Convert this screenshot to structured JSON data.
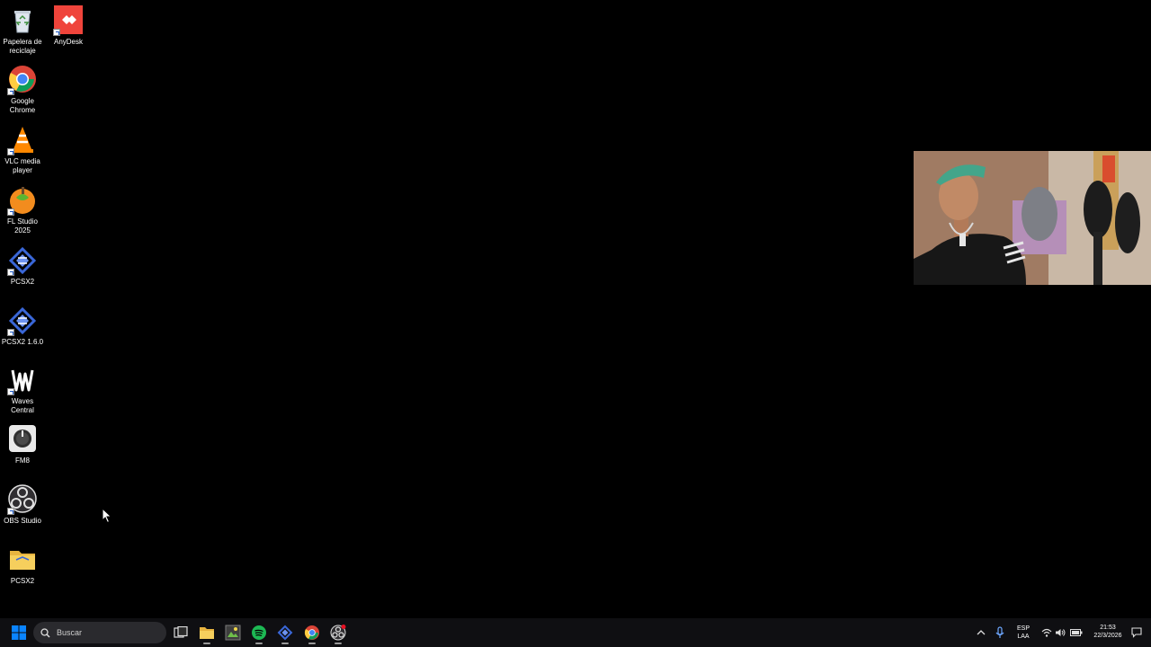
{
  "desktop": {
    "icons": [
      {
        "id": "recycle-bin",
        "label": "Papelera de reciclaje"
      },
      {
        "id": "anydesk",
        "label": "AnyDesk"
      },
      {
        "id": "chrome",
        "label": "Google Chrome"
      },
      {
        "id": "vlc",
        "label": "VLC media player"
      },
      {
        "id": "fl-studio",
        "label": "FL Studio 2025"
      },
      {
        "id": "pcsx2",
        "label": "PCSX2"
      },
      {
        "id": "pcsx2-160",
        "label": "PCSX2 1.6.0"
      },
      {
        "id": "waves",
        "label": "Waves Central"
      },
      {
        "id": "fm8",
        "label": "FM8"
      },
      {
        "id": "obs",
        "label": "OBS Studio"
      },
      {
        "id": "pcsx2-folder",
        "label": "PCSX2"
      }
    ]
  },
  "taskbar": {
    "search_placeholder": "Buscar",
    "apps": [
      "task-view",
      "file-explorer",
      "image-app",
      "spotify",
      "pcsx2",
      "chrome",
      "obs"
    ],
    "tray": {
      "language_line1": "ESP",
      "language_line2": "LAA",
      "time": "21:53",
      "date": "22/3/2026"
    }
  },
  "colors": {
    "taskbar_bg": "#0f0f12",
    "windows_blue": "#0a84ff",
    "anydesk_red": "#ef443b"
  }
}
